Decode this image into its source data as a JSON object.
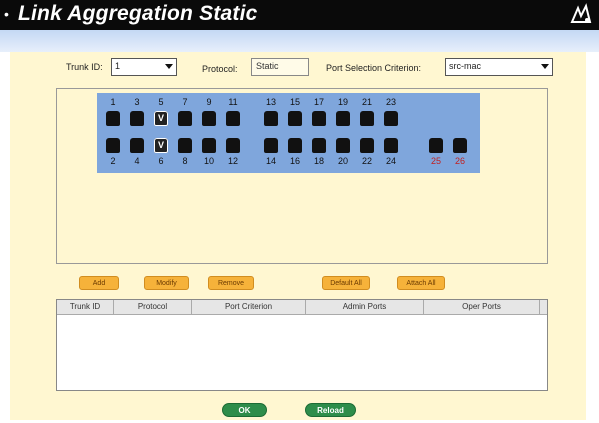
{
  "header": {
    "title": "Link Aggregation Static"
  },
  "form": {
    "trunk_id_label": "Trunk ID:",
    "trunk_id_value": "1",
    "protocol_label": "Protocol:",
    "protocol_value": "Static",
    "port_criterion_label": "Port Selection Criterion:",
    "port_criterion_value": "src-mac"
  },
  "ports": {
    "top": [
      "1",
      "3",
      "5",
      "7",
      "9",
      "11",
      "13",
      "15",
      "17",
      "19",
      "21",
      "23"
    ],
    "bottom": [
      "2",
      "4",
      "6",
      "8",
      "10",
      "12",
      "14",
      "16",
      "18",
      "20",
      "22",
      "24"
    ],
    "extra": [
      "25",
      "26"
    ],
    "selected": [
      "5",
      "6"
    ],
    "selected_mark": "V"
  },
  "actions": {
    "add": "Add",
    "modify": "Modify",
    "remove": "Remove",
    "default_all": "Default All",
    "attach_all": "Attach All"
  },
  "table": {
    "columns": [
      "Trunk ID",
      "Protocol",
      "Port Criterion",
      "Admin Ports",
      "Oper Ports"
    ]
  },
  "footer": {
    "ok": "OK",
    "reload": "Reload"
  },
  "colors": {
    "accent_orange": "#f6b23a",
    "panel_bg": "#fff7d1",
    "port_panel": "#7fa6dc",
    "button_green": "#2e8d4b"
  }
}
